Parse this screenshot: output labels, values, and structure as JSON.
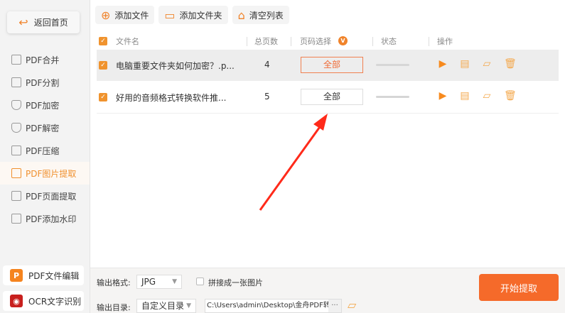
{
  "sidebar": {
    "home": "返回首页",
    "items": [
      {
        "label": "PDF合并",
        "icon": "merge-icon"
      },
      {
        "label": "PDF分割",
        "icon": "split-icon"
      },
      {
        "label": "PDF加密",
        "icon": "shield-plus-icon"
      },
      {
        "label": "PDF解密",
        "icon": "shield-minus-icon"
      },
      {
        "label": "PDF压缩",
        "icon": "compress-icon"
      },
      {
        "label": "PDF图片提取",
        "icon": "image-icon",
        "active": true
      },
      {
        "label": "PDF页面提取",
        "icon": "page-icon"
      },
      {
        "label": "PDF添加水印",
        "icon": "watermark-icon"
      }
    ],
    "apps": [
      {
        "label": "PDF文件编辑",
        "icon_text": "P",
        "color": "#f5841f"
      },
      {
        "label": "OCR文字识别",
        "icon_text": "◉",
        "color": "#c8201e"
      }
    ]
  },
  "toolbar": {
    "add_file": "添加文件",
    "add_folder": "添加文件夹",
    "clear_list": "清空列表"
  },
  "table": {
    "headers": {
      "name": "文件名",
      "pages": "总页数",
      "page_select": "页码选择",
      "page_select_badge": "V",
      "status": "状态",
      "ops": "操作"
    },
    "rows": [
      {
        "name": "电脑重要文件夹如何加密？.p...",
        "pages": "4",
        "page_select": "全部",
        "checked": true,
        "selected": true
      },
      {
        "name": "好用的音频格式转换软件推...",
        "pages": "5",
        "page_select": "全部",
        "checked": true,
        "selected": false
      }
    ]
  },
  "bottom": {
    "format_label": "输出格式:",
    "format_value": "JPG",
    "merge_label": "拼接成一张图片",
    "merge_checked": false,
    "dir_label": "输出目录:",
    "dir_mode": "自定义目录",
    "dir_path": "C:\\Users\\admin\\Desktop\\金舟PDF转换",
    "more": "···",
    "start": "开始提取"
  },
  "colors": {
    "accent": "#f0832a",
    "start": "#f56a2a",
    "annotation_arrow": "#ff2a1a"
  }
}
